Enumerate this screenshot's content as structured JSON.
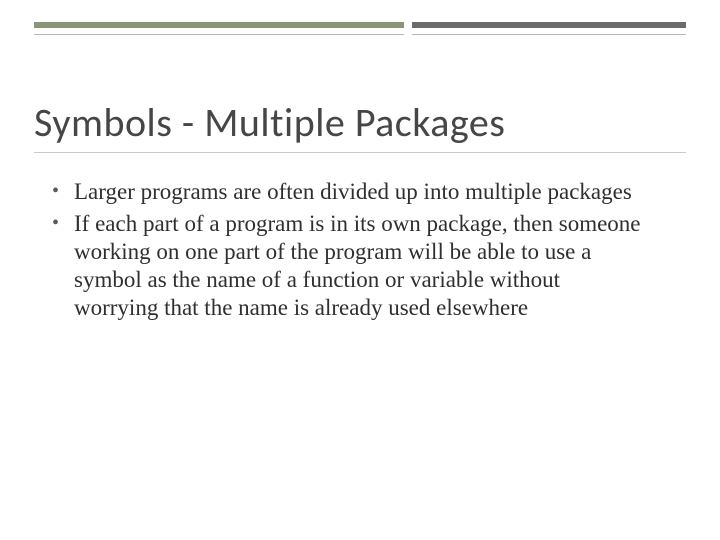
{
  "title": "Symbols - Multiple Packages",
  "bullets": [
    "Larger programs are often divided up into multiple packages",
    "If each part of a program is in its own package, then someone working on one part of the program will be able to use a symbol as the name of a function or variable without worrying that the name is already used elsewhere"
  ]
}
